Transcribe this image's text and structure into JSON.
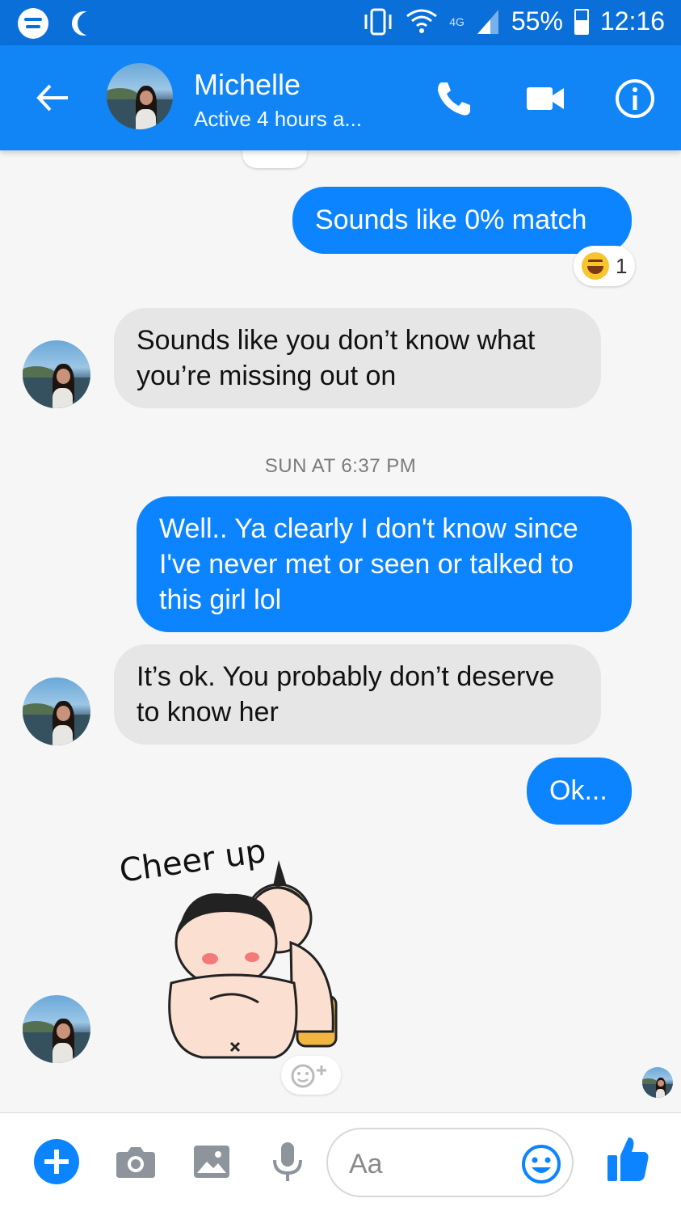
{
  "status_bar": {
    "network": "4G",
    "battery": "55%",
    "time": "12:16",
    "icons": [
      "spotify-icon",
      "moon-icon",
      "vibrate-icon",
      "wifi-icon",
      "signal-icon",
      "battery-icon"
    ]
  },
  "header": {
    "name": "Michelle",
    "status": "Active 4 hours a...",
    "icons": [
      "back-arrow-icon",
      "phone-icon",
      "video-icon",
      "info-icon"
    ]
  },
  "messages": [
    {
      "side": "out",
      "text": "Sounds like 0% match",
      "reaction": {
        "emoji": "laughing",
        "count": "1"
      }
    },
    {
      "side": "in",
      "text": "Sounds like you don’t know what you’re missing out on"
    },
    {
      "type": "timestamp",
      "text": "SUN AT 6:37 PM"
    },
    {
      "side": "out",
      "text": "Well.. Ya clearly I don't know since I've never met or seen or talked to this girl lol"
    },
    {
      "side": "in",
      "text": "It’s ok. You probably don’t deserve to know her"
    },
    {
      "side": "out",
      "text": "Ok..."
    },
    {
      "side": "in",
      "type": "sticker",
      "text": "Cheer up"
    }
  ],
  "composer": {
    "placeholder": "Aa",
    "icons": [
      "plus-icon",
      "camera-icon",
      "image-icon",
      "microphone-icon",
      "emoji-icon",
      "thumbs-up-icon"
    ]
  },
  "colors": {
    "status_bar": "#0a6fd8",
    "header": "#1185f5",
    "outgoing_bubble": "#0d84ff",
    "incoming_bubble": "#e6e6e6",
    "accent": "#0d84ff"
  }
}
